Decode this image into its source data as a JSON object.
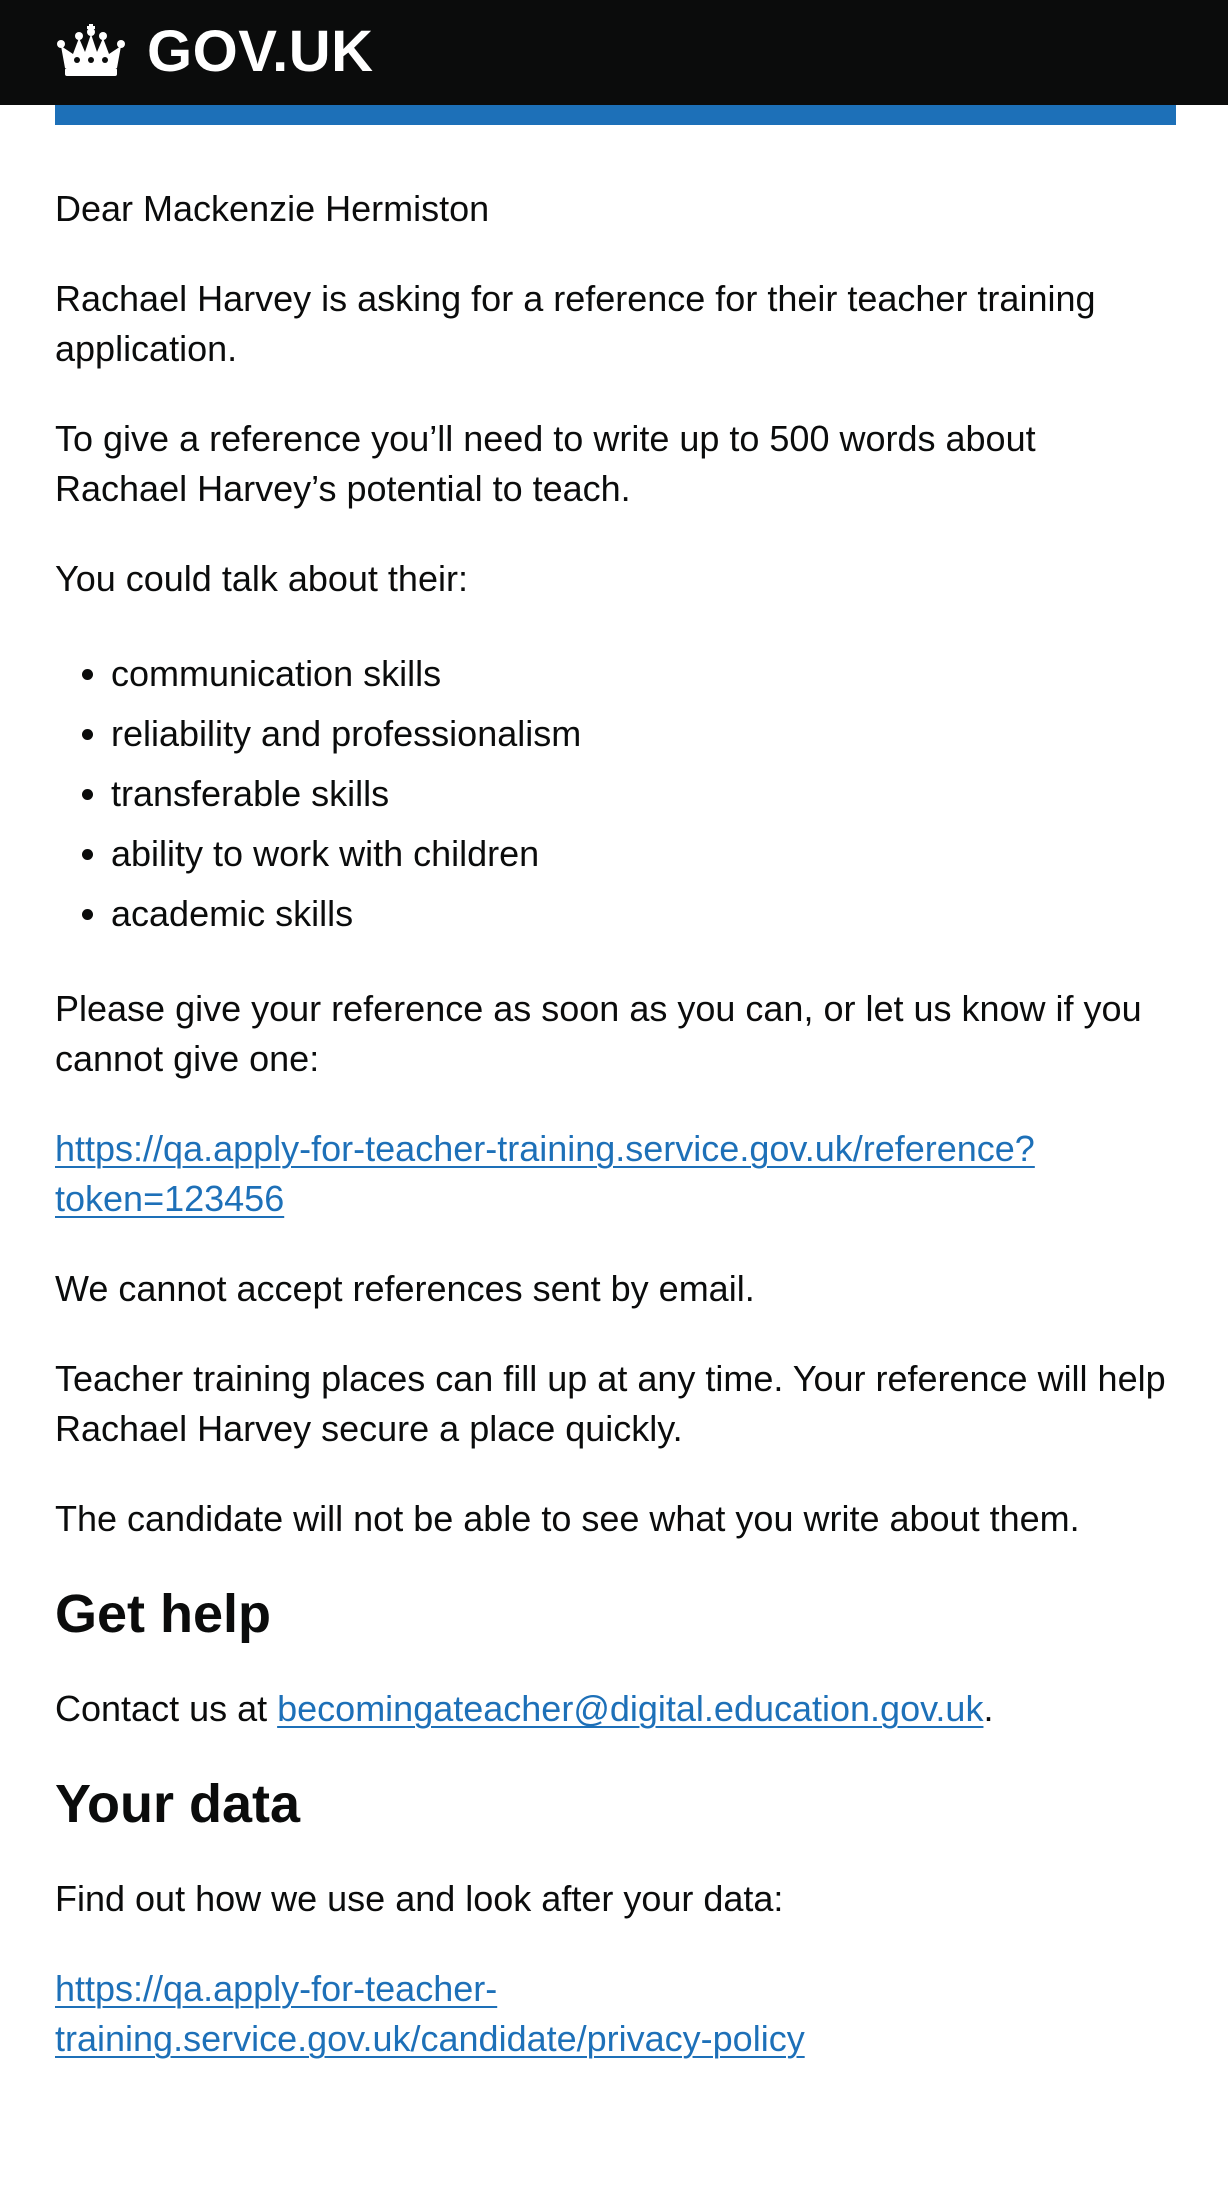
{
  "header": {
    "logo_text": "GOV.UK",
    "logo_icon": "crown-icon",
    "background_color": "#0b0c0c",
    "accent_bar_color": "#1d70b8"
  },
  "email": {
    "greeting": "Dear Mackenzie Hermiston",
    "intro": "Rachael Harvey is asking for a reference for their teacher training application.",
    "instructions": "To give a reference you’ll need to write up to 500 words about Rachael Harvey’s potential to teach.",
    "talk_about": "You could talk about their:",
    "skills": [
      "communication skills",
      "reliability and professionalism",
      "transferable skills",
      "ability to work with children",
      "academic skills"
    ],
    "please_give": "Please give your reference as soon as you can, or let us know if you cannot give one:",
    "reference_link": "https://qa.apply-for-teacher-training.service.gov.uk/reference?token=123456",
    "no_email": "We cannot accept references sent by email.",
    "places_fill": "Teacher training places can fill up at any time. Your reference will help Rachael Harvey secure a place quickly.",
    "candidate_note": "The candidate will not be able to see what you write about them."
  },
  "get_help": {
    "heading": "Get help",
    "contact_prefix": "Contact us at ",
    "contact_email": "becomingateacher@digital.education.gov.uk",
    "contact_suffix": "."
  },
  "your_data": {
    "heading": "Your data",
    "text": "Find out how we use and look after your data:",
    "privacy_link": "https://qa.apply-for-teacher-training.service.gov.uk/candidate/privacy-policy"
  },
  "link_color": "#1d70b8"
}
